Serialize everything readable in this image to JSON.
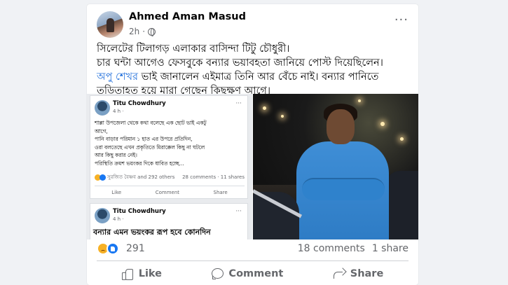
{
  "post": {
    "author": "Ahmed Aman Masud",
    "time": "2h",
    "separator": "·",
    "more": "···",
    "text_line1": "সিলেটের টিলাগড় এলাকার বাসিন্দা টিটু চৌধুরী।",
    "text_line2": "চার ঘন্টা আগেও ফেসবুকে বন্যার ভয়াবহতা জানিয়ে পোস্ট দিয়েছিলেন।",
    "text_tag": "অপু শেখর",
    "text_line3_rest": " ভাই জানালেন এইমাত্র তিনি আর বেঁচে নাই। বন্যার পানিতে",
    "text_line4": "তড়িতাহত হয়ে মারা গেছেন কিছুক্ষণ আগে।"
  },
  "screenshot": {
    "name": "Titu Chowdhury",
    "time": "4 h ·",
    "more": "···",
    "body_line1": "শাল্লা উপজেলা থেকে কথা বলেছে এক ছোট ভাই একটু",
    "body_line2": "আগে,",
    "body_line3": "পানি বাড়ার পরিমান ১ হাত এর উপরে প্রতিদিন,",
    "body_line4": "ওরা বলতেছে এখন প্রকৃতিতে  মিরাক্কেল কিছু না ঘটলে",
    "body_line5": "আর কিছু করার নেই।",
    "body_line6": "পরিস্থিতি ক্রমশ ভয়ংকর দিকে ধাবিত হচ্ছে...",
    "reactions": "সুরজিত বৈষ্ণব and 292 others",
    "counts": "28 comments · 11 shares",
    "like": "Like",
    "comment": "Comment",
    "share": "Share",
    "second_name": "Titu Chowdhury",
    "second_time": "4 h ·",
    "second_more": "···",
    "second_body": "বন্যার এমন ভয়ংকর রূপ হবে কোনদিন"
  },
  "stats": {
    "reaction_count": "291",
    "comments": "18 comments",
    "shares": "1 share"
  },
  "actions": {
    "like": "Like",
    "comment": "Comment",
    "share": "Share"
  },
  "icons": [
    "globe-icon",
    "sad-reaction-icon",
    "like-reaction-icon",
    "like-icon",
    "comment-icon",
    "share-icon"
  ],
  "colors": {
    "link": "#216fdb",
    "muted": "#65676b",
    "like_blue": "#1877f2",
    "sad_yellow": "#f7b125"
  }
}
